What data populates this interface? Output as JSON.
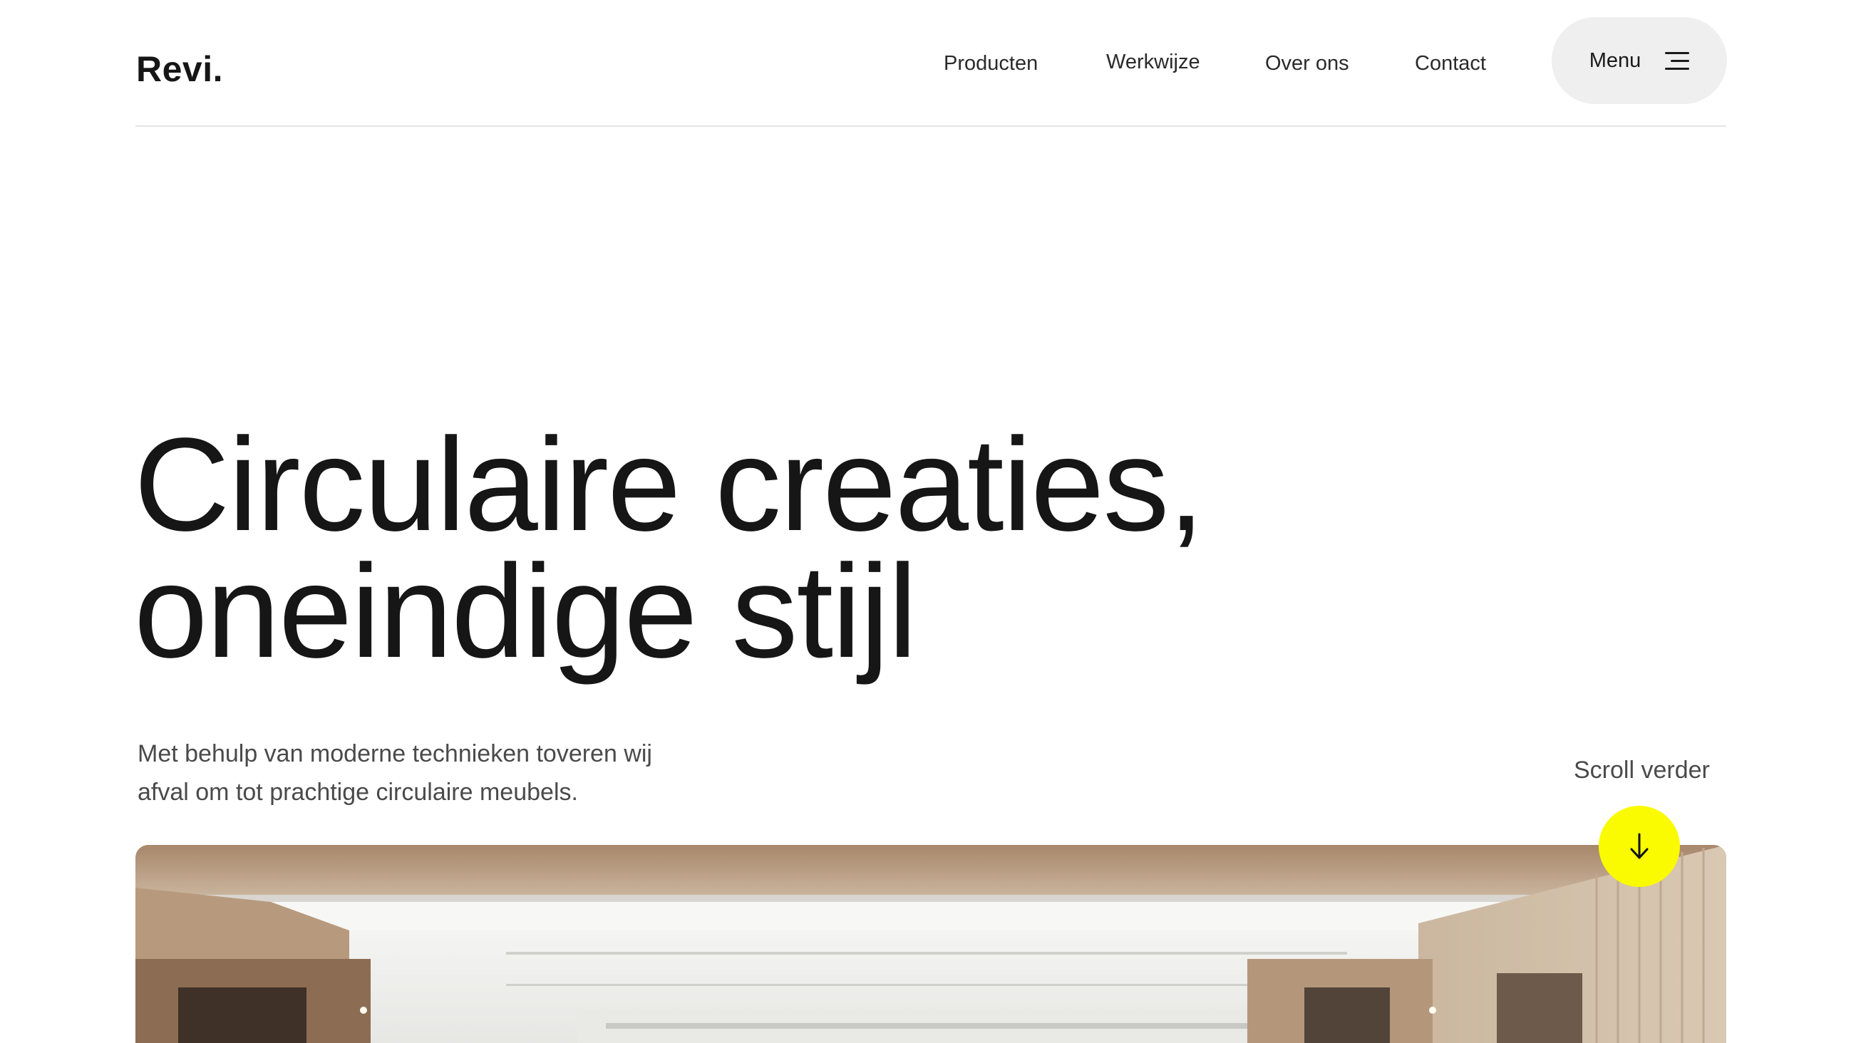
{
  "header": {
    "logo": "Revi.",
    "nav": [
      "Producten",
      "Werkwijze",
      "Over ons",
      "Contact"
    ],
    "menu_label": "Menu"
  },
  "hero": {
    "title_line1": "Circulaire creaties,",
    "title_line2": "oneindige stijl",
    "subtitle_line1": "Met behulp van moderne technieken toveren wij",
    "subtitle_line2": "afval om tot prachtige circulaire meubels.",
    "scroll_label": "Scroll verder"
  },
  "icons": {
    "menu": "hamburger-icon",
    "scroll": "arrow-down-icon"
  },
  "colors": {
    "accent": "#fafa00",
    "text": "#161616",
    "menu_bg": "#efefef"
  }
}
